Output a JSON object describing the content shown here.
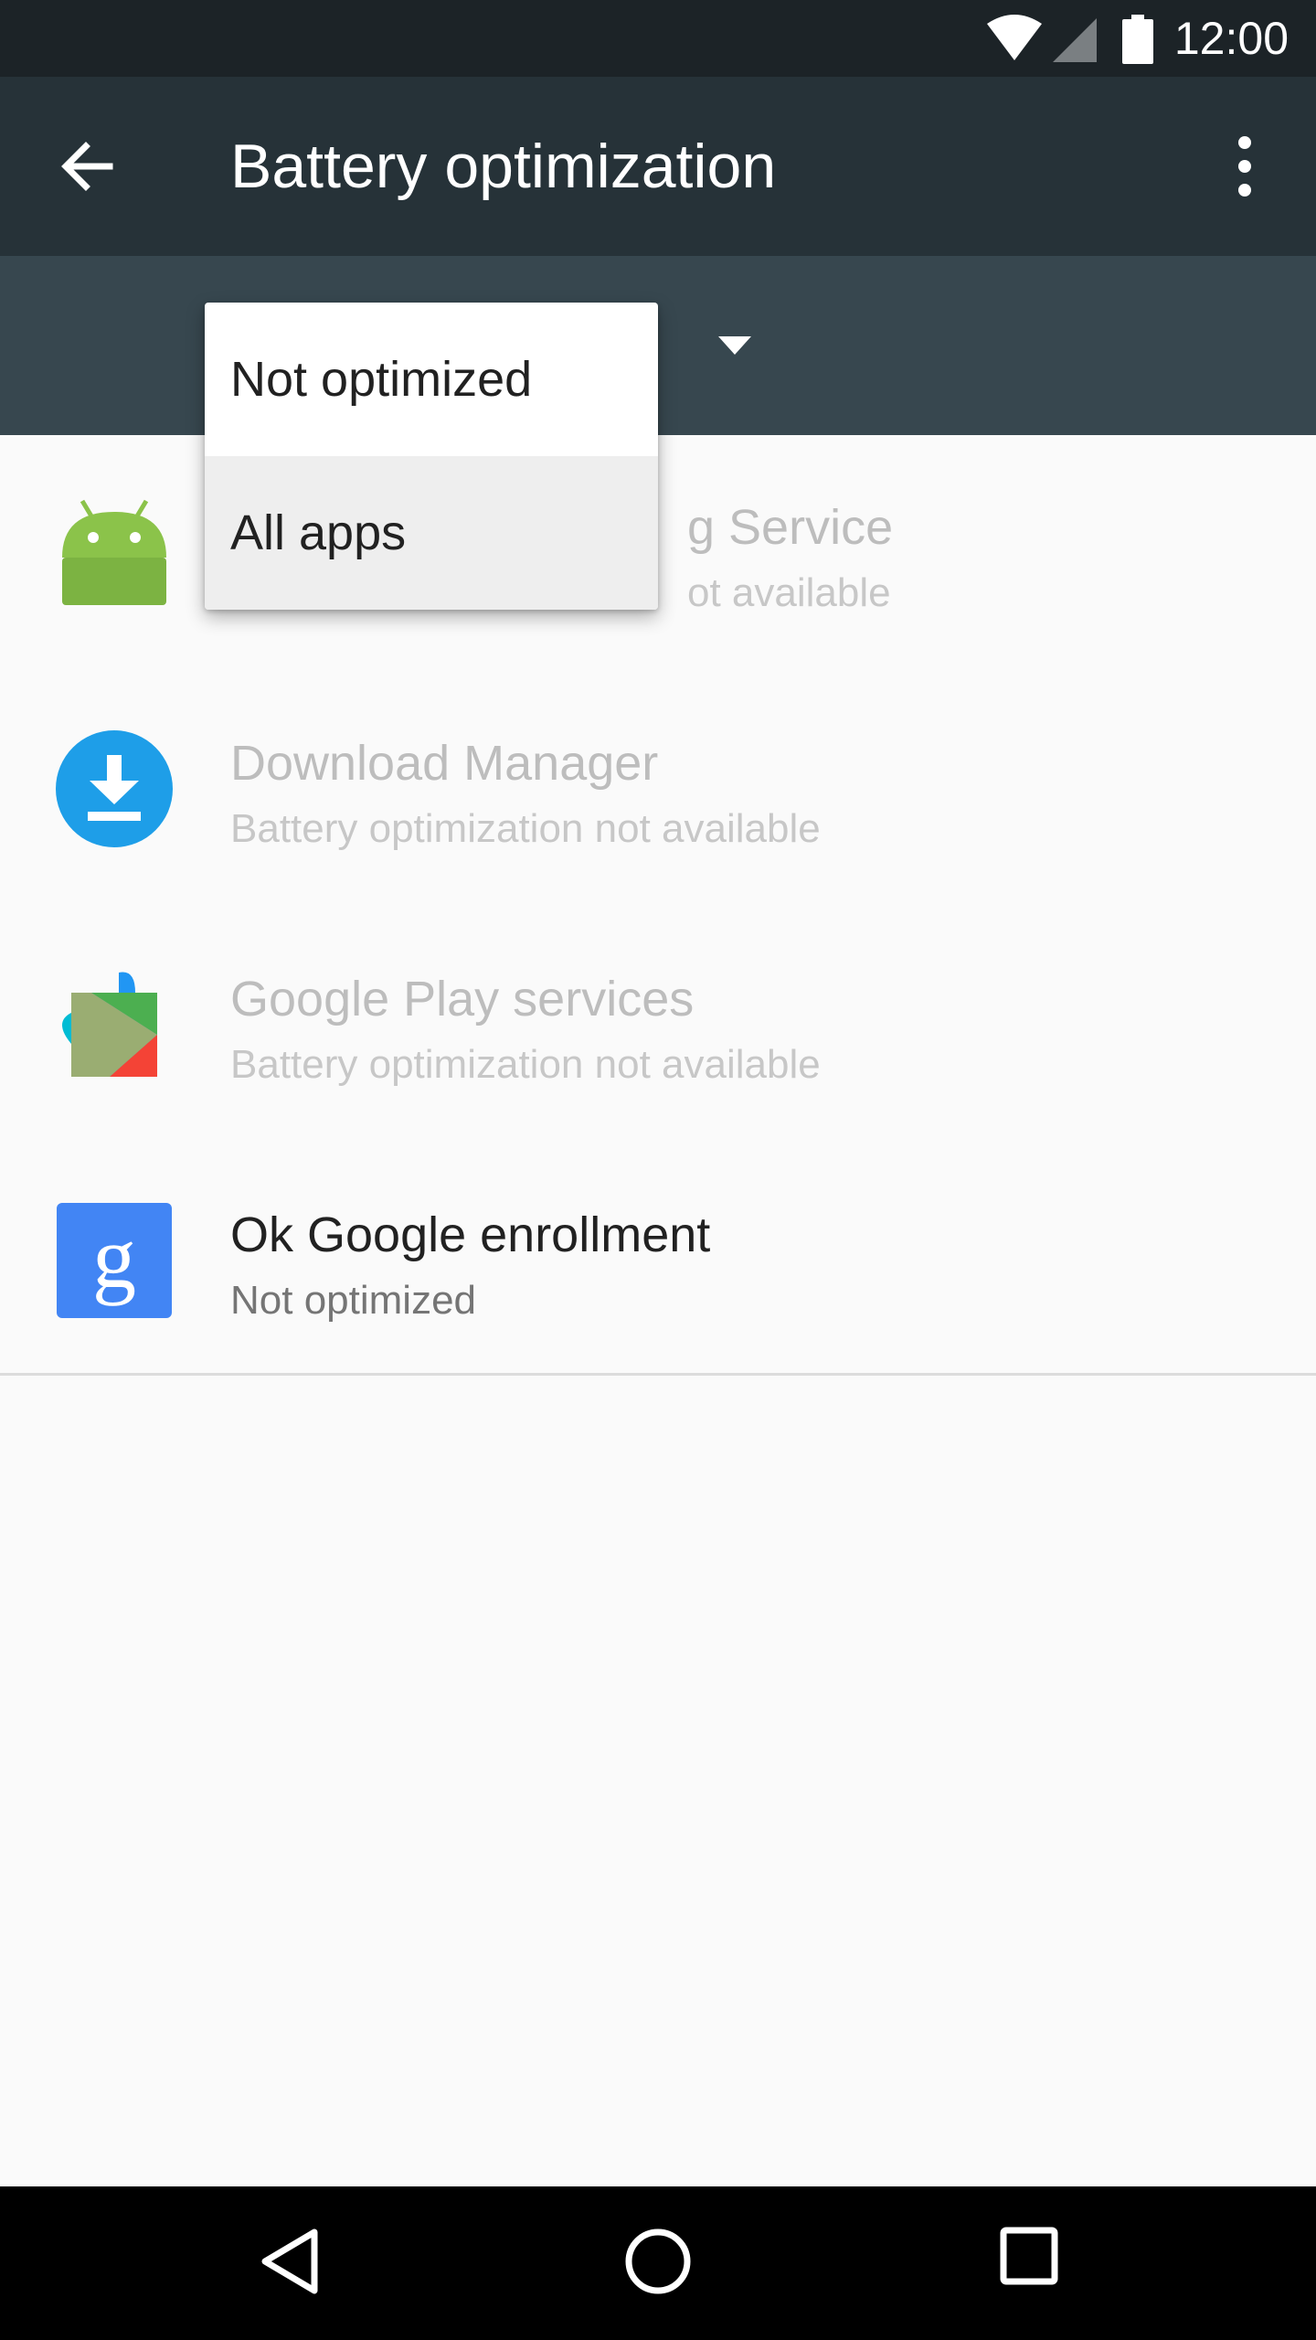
{
  "status_bar": {
    "time": "12:00",
    "icons": [
      "wifi-icon",
      "signal-icon",
      "battery-icon"
    ]
  },
  "toolbar": {
    "title": "Battery optimization",
    "back_icon": "arrow-back-icon",
    "overflow_icon": "more-vert-icon"
  },
  "filter": {
    "dropdown_icon": "triangle-down-icon",
    "options": [
      {
        "label": "Not optimized",
        "selected": false
      },
      {
        "label": "All apps",
        "selected": true
      }
    ]
  },
  "apps": [
    {
      "name": "Android Setup Tracking Service",
      "visible_name": "g Service",
      "summary": "Battery optimization not available",
      "visible_summary": "ot available",
      "enabled": false,
      "icon": "android-icon"
    },
    {
      "name": "Download Manager",
      "summary": "Battery optimization not available",
      "enabled": false,
      "icon": "download-icon"
    },
    {
      "name": "Google Play services",
      "summary": "Battery optimization not available",
      "enabled": false,
      "icon": "play-services-icon"
    },
    {
      "name": "Ok Google enrollment",
      "summary": "Not optimized",
      "enabled": true,
      "icon": "google-g-icon"
    }
  ],
  "colors": {
    "status_bar": "#1c2327",
    "toolbar": "#263238",
    "filter_bar": "#37474f",
    "background": "#fafafa"
  },
  "nav_bar": {
    "icons": [
      "nav-back-icon",
      "nav-home-icon",
      "nav-recents-icon"
    ]
  }
}
